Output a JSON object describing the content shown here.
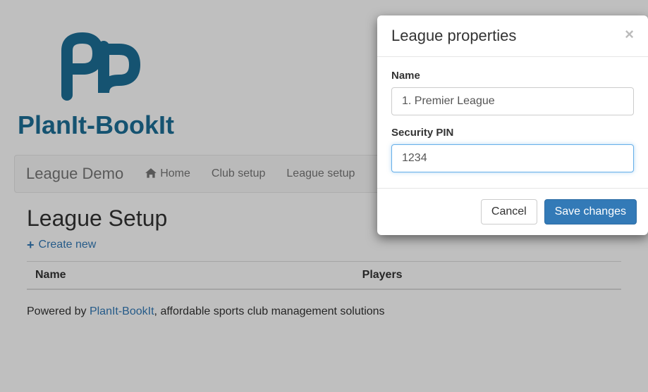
{
  "brand": {
    "text": "PlanIt-BookIt"
  },
  "nav": {
    "brand": "League Demo",
    "items": [
      {
        "label": "Home",
        "icon": "home"
      },
      {
        "label": "Club setup"
      },
      {
        "label": "League setup"
      }
    ]
  },
  "page": {
    "title": "League Setup",
    "create_label": "Create new",
    "table": {
      "columns": [
        "Name",
        "Players"
      ]
    }
  },
  "footer": {
    "prefix": "Powered by ",
    "link": "PlanIt-BookIt",
    "suffix": ", affordable sports club management solutions"
  },
  "modal": {
    "title": "League properties",
    "fields": {
      "name": {
        "label": "Name",
        "value": "1. Premier League"
      },
      "pin": {
        "label": "Security PIN",
        "value": "1234"
      }
    },
    "buttons": {
      "cancel": "Cancel",
      "save": "Save changes"
    }
  }
}
